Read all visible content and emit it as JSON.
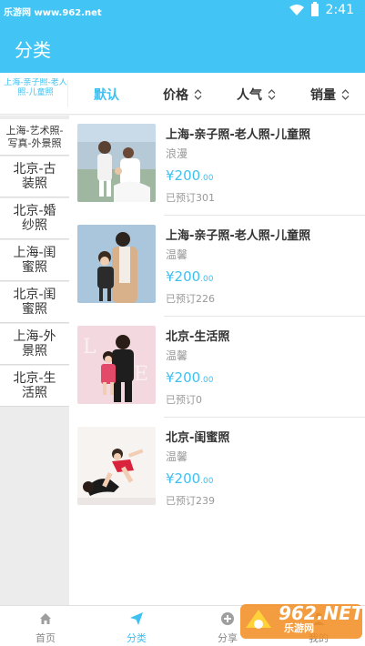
{
  "status_bar": {
    "carrier_text": "乐游网 www.962.net",
    "time": "2:41"
  },
  "header": {
    "title": "分类"
  },
  "filter": {
    "current_category": "上海-亲子照-老人照-儿童照",
    "sort_default": "默认",
    "sort_price": "价格",
    "sort_popularity": "人气",
    "sort_sales": "销量"
  },
  "sidebar": {
    "items": [
      {
        "label": "上海-艺术照-写真-外景照"
      },
      {
        "label": "北京-古装照"
      },
      {
        "label": "北京-婚纱照"
      },
      {
        "label": "上海-闺蜜照"
      },
      {
        "label": "北京-闺蜜照"
      },
      {
        "label": "上海-外景照"
      },
      {
        "label": "北京-生活照"
      }
    ]
  },
  "products": [
    {
      "title": "上海-亲子照-老人照-儿童照",
      "tag": "浪漫",
      "price_main": "¥200",
      "price_decimal": ".00",
      "booked": "已预订301"
    },
    {
      "title": "上海-亲子照-老人照-儿童照",
      "tag": "温馨",
      "price_main": "¥200",
      "price_decimal": ".00",
      "booked": "已预订226"
    },
    {
      "title": "北京-生活照",
      "tag": "温馨",
      "price_main": "¥200",
      "price_decimal": ".00",
      "booked": "已预订0"
    },
    {
      "title": "北京-闺蜜照",
      "tag": "温馨",
      "price_main": "¥200",
      "price_decimal": ".00",
      "booked": "已预订239"
    }
  ],
  "bottom_nav": {
    "items": [
      {
        "label": "首页",
        "icon": "home-icon"
      },
      {
        "label": "分类",
        "icon": "send-icon"
      },
      {
        "label": "分享",
        "icon": "share-icon"
      },
      {
        "label": "我的",
        "icon": "profile-icon"
      }
    ]
  },
  "watermark": {
    "brand": "962.NET",
    "name": "乐游网"
  },
  "colors": {
    "accent": "#42c5f5",
    "price": "#3ec0f1",
    "sidebar_bg": "#ececec"
  }
}
